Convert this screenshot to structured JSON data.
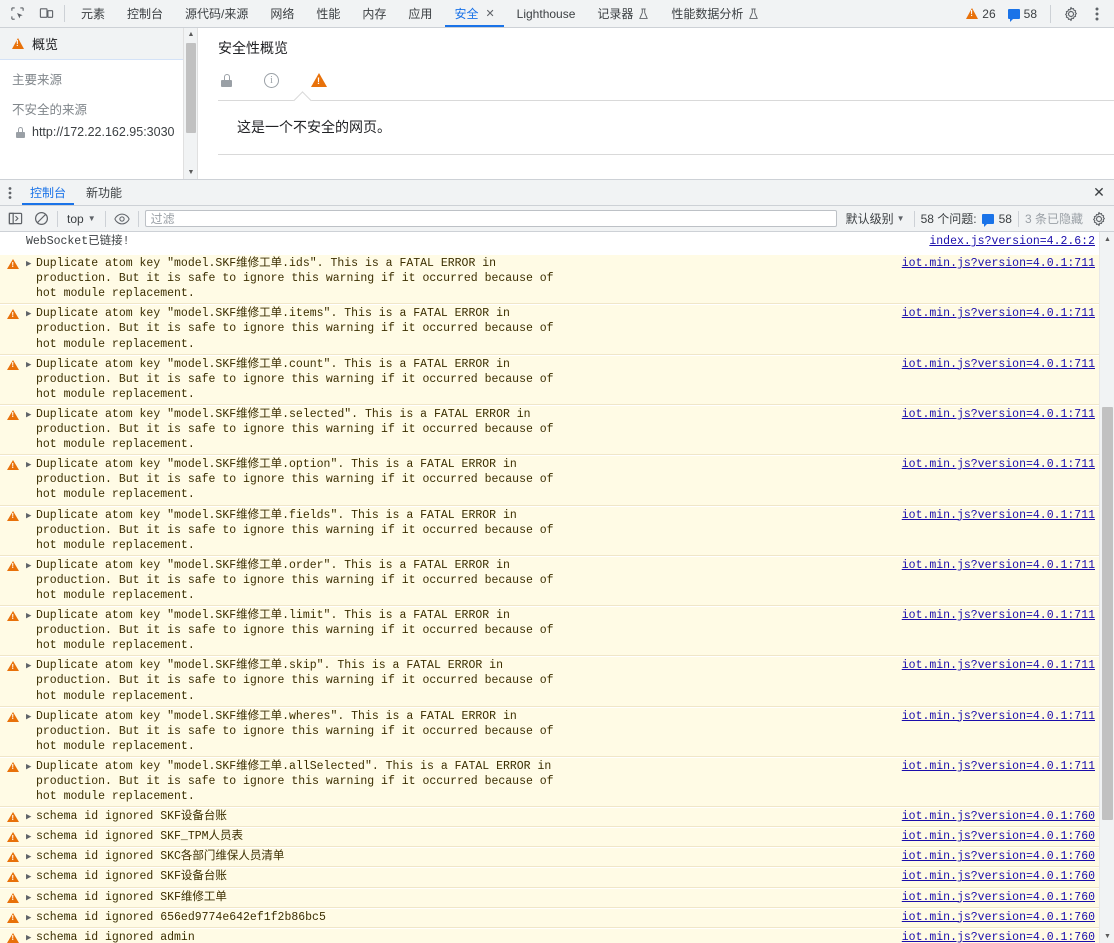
{
  "toolbar": {
    "inspect_icon": "inspect-element-icon",
    "device_icon": "device-toolbar-icon",
    "tabs": [
      {
        "label": "元素",
        "active": false,
        "flask": false,
        "close": false
      },
      {
        "label": "控制台",
        "active": false,
        "flask": false,
        "close": false
      },
      {
        "label": "源代码/来源",
        "active": false,
        "flask": false,
        "close": false
      },
      {
        "label": "网络",
        "active": false,
        "flask": false,
        "close": false
      },
      {
        "label": "性能",
        "active": false,
        "flask": false,
        "close": false
      },
      {
        "label": "内存",
        "active": false,
        "flask": false,
        "close": false
      },
      {
        "label": "应用",
        "active": false,
        "flask": false,
        "close": false
      },
      {
        "label": "安全",
        "active": true,
        "flask": false,
        "close": true
      },
      {
        "label": "Lighthouse",
        "active": false,
        "flask": false,
        "close": false
      },
      {
        "label": "记录器",
        "active": false,
        "flask": true,
        "close": false
      },
      {
        "label": "性能数据分析",
        "active": false,
        "flask": true,
        "close": false
      }
    ],
    "close_glyph": "✕",
    "warning_count": "26",
    "message_count": "58",
    "settings_icon": "gear-icon",
    "more_icon": "kebab-menu-icon"
  },
  "security": {
    "sidebar": {
      "overview_label": "概览",
      "group_main_origin": "主要来源",
      "group_insecure_origins": "不安全的来源",
      "origin": "http://172.22.162.95:3030"
    },
    "title": "安全性概览",
    "chips": [
      "lock-icon",
      "info-icon",
      "warning-icon"
    ],
    "summary": "这是一个不安全的网页。"
  },
  "drawer": {
    "tabs": [
      {
        "label": "控制台",
        "active": true
      },
      {
        "label": "新功能",
        "active": false
      }
    ],
    "close_glyph": "✕",
    "console_toolbar": {
      "sidebar_toggle_icon": "console-sidebar-icon",
      "clear_icon": "clear-console-icon",
      "context_value": "top",
      "eye_icon": "live-expression-icon",
      "filter_placeholder": "过滤",
      "filter_value": "",
      "level_label": "默认级别",
      "issues_label": "58 个问题:",
      "issues_count": "58",
      "hidden_label": "3 条已隐藏",
      "settings_icon": "console-settings-gear-icon"
    }
  },
  "console": {
    "rows": [
      {
        "kind": "plain",
        "text": "WebSocket已链接!",
        "link": "index.js?version=4.2.6:2"
      },
      {
        "kind": "warn",
        "text": "Duplicate atom key \"model.SKF维修工单.ids\". This is a FATAL ERROR in\nproduction. But it is safe to ignore this warning if it occurred because of\nhot module replacement.",
        "link": "iot.min.js?version=4.0.1:711"
      },
      {
        "kind": "warn",
        "text": "Duplicate atom key \"model.SKF维修工单.items\". This is a FATAL ERROR in\nproduction. But it is safe to ignore this warning if it occurred because of\nhot module replacement.",
        "link": "iot.min.js?version=4.0.1:711"
      },
      {
        "kind": "warn",
        "text": "Duplicate atom key \"model.SKF维修工单.count\". This is a FATAL ERROR in\nproduction. But it is safe to ignore this warning if it occurred because of\nhot module replacement.",
        "link": "iot.min.js?version=4.0.1:711"
      },
      {
        "kind": "warn",
        "text": "Duplicate atom key \"model.SKF维修工单.selected\". This is a FATAL ERROR in\nproduction. But it is safe to ignore this warning if it occurred because of\nhot module replacement.",
        "link": "iot.min.js?version=4.0.1:711"
      },
      {
        "kind": "warn",
        "text": "Duplicate atom key \"model.SKF维修工单.option\". This is a FATAL ERROR in\nproduction. But it is safe to ignore this warning if it occurred because of\nhot module replacement.",
        "link": "iot.min.js?version=4.0.1:711"
      },
      {
        "kind": "warn",
        "text": "Duplicate atom key \"model.SKF维修工单.fields\". This is a FATAL ERROR in\nproduction. But it is safe to ignore this warning if it occurred because of\nhot module replacement.",
        "link": "iot.min.js?version=4.0.1:711"
      },
      {
        "kind": "warn",
        "text": "Duplicate atom key \"model.SKF维修工单.order\". This is a FATAL ERROR in\nproduction. But it is safe to ignore this warning if it occurred because of\nhot module replacement.",
        "link": "iot.min.js?version=4.0.1:711"
      },
      {
        "kind": "warn",
        "text": "Duplicate atom key \"model.SKF维修工单.limit\". This is a FATAL ERROR in\nproduction. But it is safe to ignore this warning if it occurred because of\nhot module replacement.",
        "link": "iot.min.js?version=4.0.1:711"
      },
      {
        "kind": "warn",
        "text": "Duplicate atom key \"model.SKF维修工单.skip\". This is a FATAL ERROR in\nproduction. But it is safe to ignore this warning if it occurred because of\nhot module replacement.",
        "link": "iot.min.js?version=4.0.1:711"
      },
      {
        "kind": "warn",
        "text": "Duplicate atom key \"model.SKF维修工单.wheres\". This is a FATAL ERROR in\nproduction. But it is safe to ignore this warning if it occurred because of\nhot module replacement.",
        "link": "iot.min.js?version=4.0.1:711"
      },
      {
        "kind": "warn",
        "text": "Duplicate atom key \"model.SKF维修工单.allSelected\". This is a FATAL ERROR in\nproduction. But it is safe to ignore this warning if it occurred because of\nhot module replacement.",
        "link": "iot.min.js?version=4.0.1:711"
      },
      {
        "kind": "warn",
        "single": true,
        "text": "schema id ignored SKF设备台账",
        "link": "iot.min.js?version=4.0.1:760"
      },
      {
        "kind": "warn",
        "single": true,
        "text": "schema id ignored SKF_TPM人员表",
        "link": "iot.min.js?version=4.0.1:760"
      },
      {
        "kind": "warn",
        "single": true,
        "text": "schema id ignored SKC各部门维保人员清单",
        "link": "iot.min.js?version=4.0.1:760"
      },
      {
        "kind": "warn",
        "single": true,
        "text": "schema id ignored SKF设备台账",
        "link": "iot.min.js?version=4.0.1:760"
      },
      {
        "kind": "warn",
        "single": true,
        "text": "schema id ignored SKF维修工单",
        "link": "iot.min.js?version=4.0.1:760"
      },
      {
        "kind": "warn",
        "single": true,
        "text": "schema id ignored 656ed9774e642ef1f2b86bc5",
        "link": "iot.min.js?version=4.0.1:760"
      },
      {
        "kind": "warn",
        "single": true,
        "text": "schema id ignored admin",
        "link": "iot.min.js?version=4.0.1:760"
      }
    ]
  },
  "colors": {
    "accent": "#1a73e8",
    "warning": "#e8710a",
    "warn_row_bg": "#fffbe5",
    "link": "#1a0dab",
    "chrome_bg": "#f1f3f4"
  }
}
